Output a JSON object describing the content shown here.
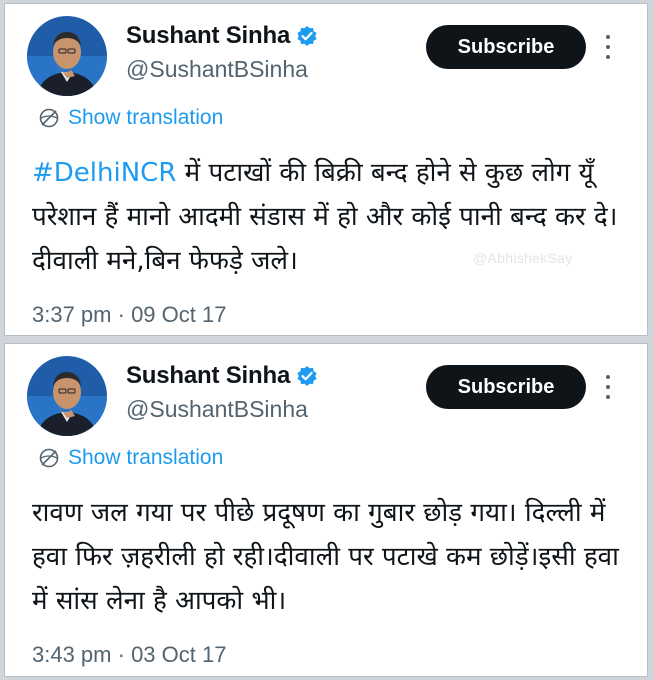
{
  "tweets": [
    {
      "author": {
        "name": "Sushant Sinha",
        "handle": "@SushantBSinha"
      },
      "subscribe_label": "Subscribe",
      "show_translation": "Show translation",
      "hashtag": "#DelhiNCR",
      "text": " में पटाखों की बिक्री बन्द होने से कुछ लोग यूँ परेशान हैं मानो आदमी संडास में हो और कोई पानी बन्द कर दे। दीवाली मने,बिन फेफड़े जले।",
      "watermark": "@AbhishekSay",
      "time": "3:37 pm",
      "separator": " · ",
      "date": "09 Oct 17"
    },
    {
      "author": {
        "name": "Sushant Sinha",
        "handle": "@SushantBSinha"
      },
      "subscribe_label": "Subscribe",
      "show_translation": "Show translation",
      "text": "रावण जल गया पर पीछे प्रदूषण का गुबार छोड़ गया। दिल्ली में हवा फिर ज़हरीली हो रही।दीवाली पर पटाखे कम छोड़ें।इसी हवा में सांस लेना है आपको भी।",
      "time": "3:43 pm",
      "separator": " · ",
      "date": "03 Oct 17"
    }
  ],
  "colors": {
    "link": "#1d9bf0",
    "verified": "#1d9bf0",
    "subscribe_bg": "#0f1419",
    "secondary_text": "#536471"
  },
  "icons": {
    "verified": "verified-badge-icon",
    "more": "more-vertical-icon",
    "translate": "globe-icon"
  }
}
